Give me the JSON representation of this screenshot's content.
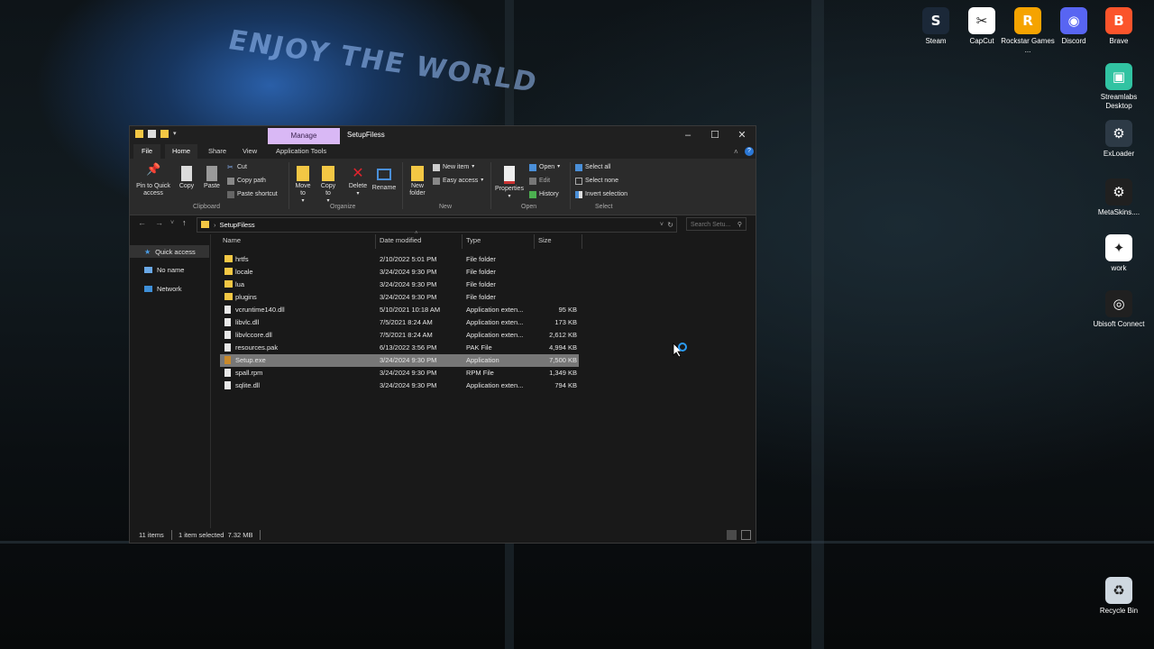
{
  "wallpaper": {
    "sign_text": "ENJOY THE WORLD"
  },
  "desktop_icons": [
    {
      "label": "Steam",
      "color": "#1b2838",
      "glyph": "S"
    },
    {
      "label": "CapCut",
      "color": "#ffffff",
      "glyph": "✂"
    },
    {
      "label": "Rockstar Games ...",
      "color": "#f5a300",
      "glyph": "R"
    },
    {
      "label": "Discord",
      "color": "#5865f2",
      "glyph": "◉"
    },
    {
      "label": "Brave",
      "color": "#fb542b",
      "glyph": "B"
    },
    {
      "label": "Streamlabs Desktop",
      "color": "#31c3a2",
      "glyph": "▣"
    },
    {
      "label": "ExLoader",
      "color": "#2d3a46",
      "glyph": "⚙"
    },
    {
      "label": "MetaSkins....",
      "color": "#202020",
      "glyph": "⚙"
    },
    {
      "label": "work",
      "color": "#ffffff",
      "glyph": "✦"
    },
    {
      "label": "Ubisoft Connect",
      "color": "#202020",
      "glyph": "◎"
    },
    {
      "label": "Recycle Bin",
      "color": "#cfd8e0",
      "glyph": "♻"
    }
  ],
  "window": {
    "title": "SetupFiless",
    "contextual_tab": "Manage",
    "tabs": [
      "File",
      "Home",
      "Share",
      "View",
      "Application Tools"
    ],
    "active_tab": "Home",
    "ribbon": {
      "clipboard": {
        "pin": "Pin to Quick access",
        "copy": "Copy",
        "paste": "Paste",
        "cut": "Cut",
        "copy_path": "Copy path",
        "paste_shortcut": "Paste shortcut",
        "label": "Clipboard"
      },
      "organize": {
        "move_to": "Move to",
        "copy_to": "Copy to",
        "delete": "Delete",
        "rename": "Rename",
        "label": "Organize"
      },
      "new": {
        "new_folder": "New folder",
        "new_item": "New item",
        "easy_access": "Easy access",
        "label": "New"
      },
      "open": {
        "properties": "Properties",
        "open": "Open",
        "edit": "Edit",
        "history": "History",
        "label": "Open"
      },
      "select": {
        "select_all": "Select all",
        "select_none": "Select none",
        "invert": "Invert selection",
        "label": "Select"
      }
    },
    "address": "SetupFiless",
    "search_placeholder": "Search Setu...",
    "nav_pane": [
      "Quick access",
      "No name",
      "Network"
    ],
    "columns": [
      "Name",
      "Date modified",
      "Type",
      "Size"
    ],
    "files": [
      {
        "name": "hrtfs",
        "date": "2/10/2022 5:01 PM",
        "type": "File folder",
        "size": "",
        "kind": "folder"
      },
      {
        "name": "locale",
        "date": "3/24/2024 9:30 PM",
        "type": "File folder",
        "size": "",
        "kind": "folder"
      },
      {
        "name": "lua",
        "date": "3/24/2024 9:30 PM",
        "type": "File folder",
        "size": "",
        "kind": "folder"
      },
      {
        "name": "plugins",
        "date": "3/24/2024 9:30 PM",
        "type": "File folder",
        "size": "",
        "kind": "folder"
      },
      {
        "name": "vcruntime140.dll",
        "date": "5/10/2021 10:18 AM",
        "type": "Application exten...",
        "size": "95 KB",
        "kind": "file"
      },
      {
        "name": "libvlc.dll",
        "date": "7/5/2021 8:24 AM",
        "type": "Application exten...",
        "size": "173 KB",
        "kind": "file"
      },
      {
        "name": "libvlccore.dll",
        "date": "7/5/2021 8:24 AM",
        "type": "Application exten...",
        "size": "2,612 KB",
        "kind": "file"
      },
      {
        "name": "resources.pak",
        "date": "6/13/2022 3:56 PM",
        "type": "PAK File",
        "size": "4,994 KB",
        "kind": "file"
      },
      {
        "name": "Setup.exe",
        "date": "3/24/2024 9:30 PM",
        "type": "Application",
        "size": "7,500 KB",
        "kind": "exe",
        "selected": true
      },
      {
        "name": "spall.rpm",
        "date": "3/24/2024 9:30 PM",
        "type": "RPM File",
        "size": "1,349 KB",
        "kind": "file"
      },
      {
        "name": "sqlite.dll",
        "date": "3/24/2024 9:30 PM",
        "type": "Application exten...",
        "size": "794 KB",
        "kind": "file"
      }
    ],
    "status": {
      "items": "11 items",
      "selected": "1 item selected  7.32 MB"
    }
  }
}
